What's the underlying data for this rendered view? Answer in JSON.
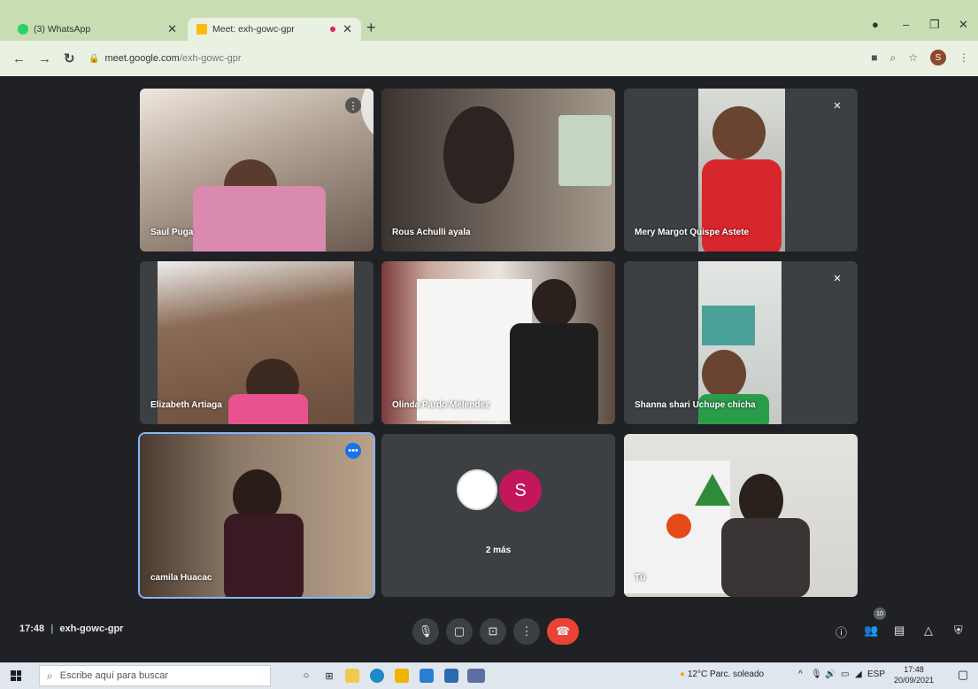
{
  "browser": {
    "tabs": [
      {
        "label": "(3) WhatsApp",
        "icon": "whatsapp-icon",
        "color": "#25d366"
      },
      {
        "label": "Meet: exh-gowc-gpr",
        "icon": "meet-icon",
        "color": "#fbbc04"
      }
    ],
    "url_host": "meet.google.com",
    "url_path": "/exh-gowc-gpr",
    "profile_initial": "S"
  },
  "participants": [
    {
      "name": "Saul Puga"
    },
    {
      "name": "Rous Achulli ayala"
    },
    {
      "name": "Mery Margot Quispe Astete"
    },
    {
      "name": "Elizabeth Artiaga"
    },
    {
      "name": "Olinda Pardo Melendez"
    },
    {
      "name": "Shanna shari Uchupe chicha"
    },
    {
      "name": "camila Huacac"
    },
    {
      "name": "2 más",
      "avatar_letter": "S"
    },
    {
      "name": "Tú"
    }
  ],
  "meeting": {
    "time": "17:48",
    "code": "exh-gowc-gpr",
    "participants_count": "10"
  },
  "taskbar": {
    "search_placeholder": "Escribe aquí para buscar",
    "weather": "12°C  Parc. soleado",
    "language": "ESP",
    "clock_time": "17:48",
    "clock_date": "20/09/2021"
  },
  "colors": {
    "tab_bar": "#c8ddb4",
    "meet_bg": "#202124",
    "tile_bg": "#3c4043",
    "end_call": "#ea4335",
    "avatar_s": "#c2185b"
  }
}
